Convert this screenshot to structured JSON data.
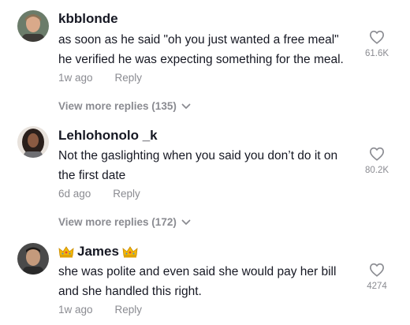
{
  "comments": [
    {
      "username": "kbblonde",
      "text_lines": [
        "as soon as he said \"oh you just wanted a free meal\"",
        "he verified he was expecting something for the meal."
      ],
      "time": "1w ago",
      "reply_label": "Reply",
      "like_count": "61.6K",
      "view_more": "View more replies (135)"
    },
    {
      "username": "Lehlohonolo _k",
      "text_lines": [
        "Not the gaslighting when you said you don’t do it on",
        "the first date"
      ],
      "time": "6d ago",
      "reply_label": "Reply",
      "like_count": "80.2K",
      "view_more": "View more replies (172)"
    },
    {
      "username": "James",
      "username_emoji": "crown",
      "text_lines": [
        "she was polite and even said she would pay her bill",
        "and she handled this right."
      ],
      "time": "1w ago",
      "reply_label": "Reply",
      "like_count": "4274"
    }
  ],
  "icons": {
    "like": "heart-outline-icon",
    "expand": "chevron-down-icon",
    "crown": "crown-emoji-icon"
  },
  "colors": {
    "primary_text": "#161823",
    "secondary_text": "#8a8b91"
  }
}
